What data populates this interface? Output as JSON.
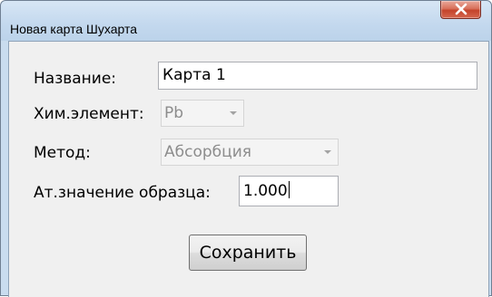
{
  "window": {
    "title": "Новая карта Шухарта",
    "close_icon": "close-icon"
  },
  "form": {
    "name_label": "Название:",
    "name_value": "Карта 1",
    "element_label": "Хим.элемент:",
    "element_value": "Pb",
    "method_label": "Метод:",
    "method_value": "Абсорбция",
    "sample_label": "Ат.значение образца:",
    "sample_value": "1.000",
    "save_label": "Сохранить"
  },
  "colors": {
    "titlebar": "#c9dcef",
    "close_button": "#c4432b",
    "client_background": "#f0f0f0",
    "disabled_text": "#8d8d8d"
  }
}
